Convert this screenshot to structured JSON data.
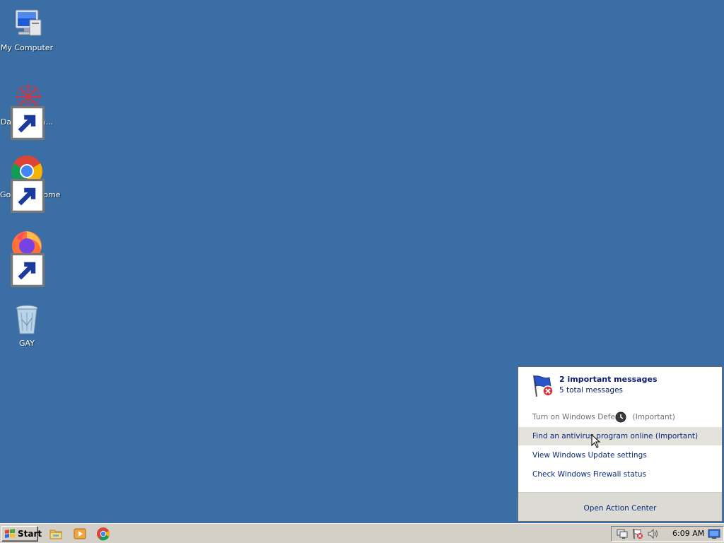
{
  "desktop": {
    "icons": [
      {
        "label": "My Computer",
        "icon": "computer-icon"
      },
      {
        "label": "DataWagon...",
        "icon": "datawagon-icon"
      },
      {
        "label": "Google Chrome",
        "icon": "chrome-icon"
      },
      {
        "label": "Firefox",
        "icon": "firefox-icon"
      },
      {
        "label": "GAY",
        "icon": "recycle-bin-icon"
      }
    ]
  },
  "action_center": {
    "title": "2 important messages",
    "subtitle": "5 total messages",
    "messages": [
      {
        "label": "Turn on Windows Defender (Important)",
        "visible_text_left": "Turn on Windows Defen",
        "visible_text_right": "(Important)",
        "state": "disabled"
      },
      {
        "label": "Find an antivirus program online (Important)",
        "state": "hover"
      },
      {
        "label": "View Windows Update settings",
        "state": "normal"
      },
      {
        "label": "Check Windows Firewall status",
        "state": "normal"
      }
    ],
    "footer_link": "Open Action Center"
  },
  "taskbar": {
    "start_label": "Start",
    "quick_launch": [
      "explorer-icon",
      "media-player-icon",
      "chrome-icon"
    ],
    "tray_icons": [
      "network-icon",
      "action-center-flag-icon",
      "volume-icon",
      "show-desktop-icon"
    ],
    "clock": "6:09 AM"
  },
  "colors": {
    "desktop_bg": "#3a6ea5",
    "taskbar_bg": "#d4d0c8",
    "link": "#0b2a7a",
    "hover_row": "#e3e2dd"
  }
}
